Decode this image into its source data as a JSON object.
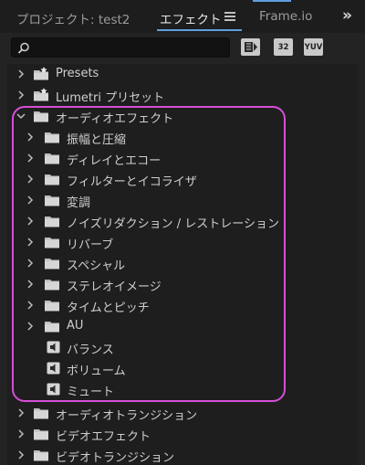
{
  "tabs": {
    "project": "プロジェクト: test2",
    "effects": "エフェクト",
    "frameio": "Frame.io"
  },
  "search": {
    "value": "",
    "placeholder": ""
  },
  "filters": {
    "accelerated": "",
    "bit32": "32",
    "yuv": "YUV"
  },
  "tree": {
    "presets": "Presets",
    "lumetri": "Lumetri プリセット",
    "audio_effects": "オーディオエフェクト",
    "ae": [
      "振幅と圧縮",
      "ディレイとエコー",
      "フィルターとイコライザ",
      "変調",
      "ノイズリダクション / レストレーション",
      "リバーブ",
      "スペシャル",
      "ステレオイメージ",
      "タイムとピッチ",
      "AU"
    ],
    "ae_items": [
      "バランス",
      "ボリューム",
      "ミュート"
    ],
    "audio_transitions": "オーディオトランジション",
    "video_effects": "ビデオエフェクト",
    "video_transitions": "ビデオトランジション"
  },
  "colors": {
    "accent": "#5f9fe0",
    "highlight": "#d54fd6"
  },
  "icons": {
    "folder": "folder-icon",
    "preset_folder": "preset-folder-icon",
    "effect": "audio-effect-icon",
    "chevron_right": "chevron-right-icon",
    "chevron_down": "chevron-down-icon"
  }
}
